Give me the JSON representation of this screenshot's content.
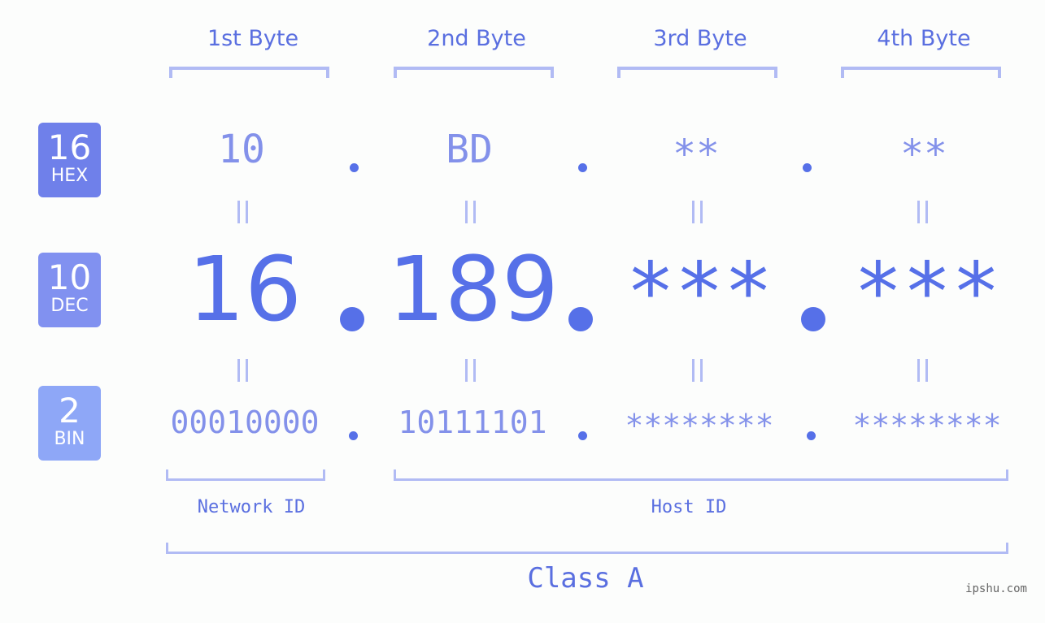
{
  "byte_headers": [
    "1st Byte",
    "2nd Byte",
    "3rd Byte",
    "4th Byte"
  ],
  "bases": [
    {
      "number": "16",
      "label": "HEX",
      "color": "#6f80ea"
    },
    {
      "number": "10",
      "label": "DEC",
      "color": "#8191f0"
    },
    {
      "number": "2",
      "label": "BIN",
      "color": "#8ea7f7"
    }
  ],
  "hex": [
    "10",
    "BD",
    "**",
    "**"
  ],
  "dec": [
    "16",
    "189",
    "***",
    "***"
  ],
  "bin": [
    "00010000",
    "10111101",
    "********",
    "********"
  ],
  "equals_symbol": "=",
  "network_id_label": "Network ID",
  "host_id_label": "Host ID",
  "class_label": "Class A",
  "watermark": "ipshu.com",
  "colors": {
    "accent": "#5670e8",
    "light_value": "#8391ea",
    "bracket": "#b1bbf4",
    "background": "#fcfdfc"
  }
}
